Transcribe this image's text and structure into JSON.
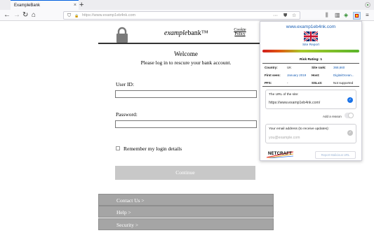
{
  "browser": {
    "tab_title": "ExampleBank",
    "tab_close": "×",
    "new_tab": "+",
    "url": "https://www.examp1eb4nk.com",
    "nav": {
      "back": "←",
      "forward": "→",
      "reload": "↻",
      "home": "⌂"
    },
    "url_icons": {
      "shield": "⛉",
      "lock": "🔒",
      "more": "···",
      "pocket": "⛊",
      "bookmark": "☆"
    },
    "toolbar_icons": {
      "library": "⫼",
      "sidebar": "▥",
      "menu": "≡"
    }
  },
  "page": {
    "bank_name_prefix": "example",
    "bank_name_suffix": "bank™",
    "cookie_policy": "Cookie Policy",
    "welcome_title": "Welcome",
    "welcome_subtitle": "Please log in to rescure your bank account.",
    "user_id_label": "User ID:",
    "password_label": "Password:",
    "remember_label": "Remember my login details",
    "continue_label": "Continue",
    "footer_links": [
      "Contact Us >",
      "Help >",
      "Security >"
    ]
  },
  "netcraft": {
    "site_url": "www.examp1eb4nk.com",
    "site_report": "Site Report",
    "risk_rating_label": "Risk Rating: 1",
    "risk_level": 1,
    "country_label": "Country:",
    "country_value": "UK",
    "site_rank_label": "Site rank:",
    "site_rank_value": "368,660",
    "first_seen_label": "First seen:",
    "first_seen_value": "January 2019",
    "host_label": "Host:",
    "host_value": "DigitalOcean...",
    "pfs_label": "PFS:",
    "pfs_value": "-",
    "sslv3_label": "SSLv3:",
    "sslv3_value": "Not supported",
    "url_card_label": "The URL of the site:",
    "url_card_value": "https://www.examp1eb4nk.com/",
    "add_reason_label": "Add a reason",
    "email_card_label": "Your email address (to receive updates):",
    "email_placeholder": "you@example.com",
    "logo_text": "NETCRAFT",
    "report_button": "Report Malicious URL",
    "colors": {
      "link": "#1a5fb4",
      "check": "#1a73e8",
      "risk_low": "#5ab52a",
      "risk_high": "#d01d1d"
    }
  }
}
